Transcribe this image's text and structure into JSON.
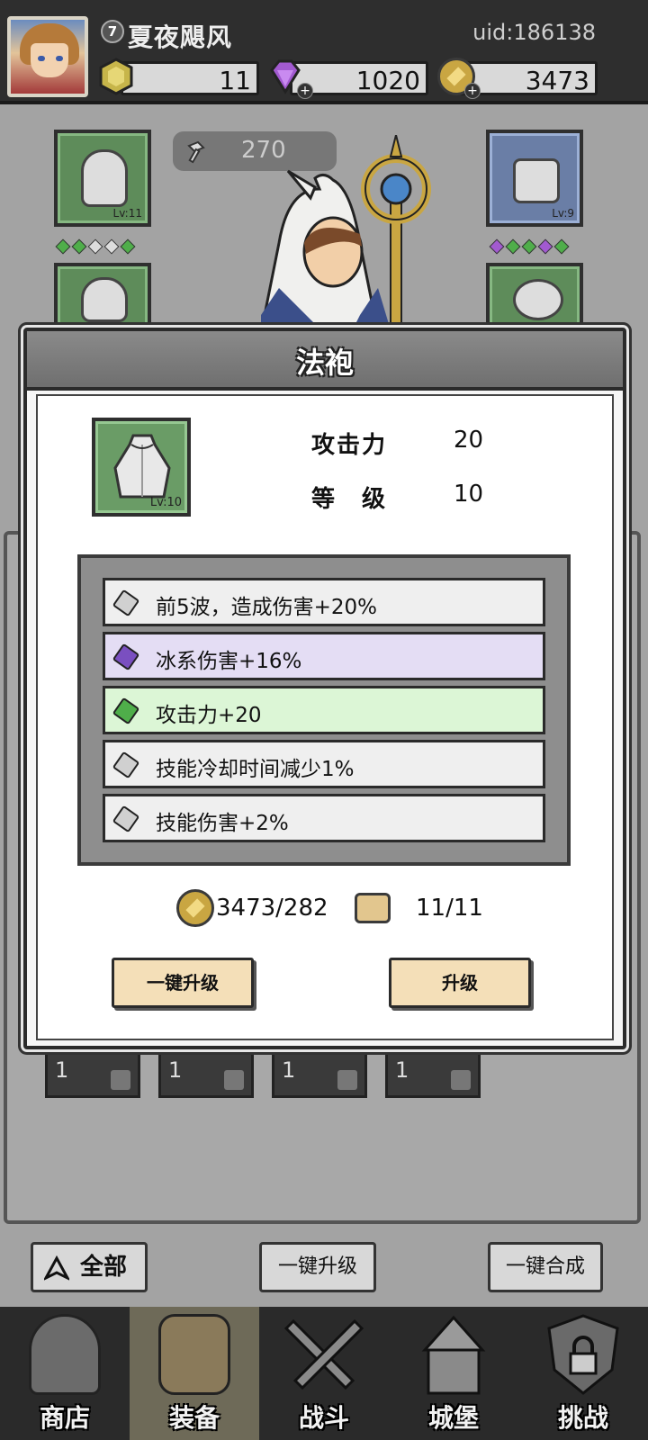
{
  "player": {
    "level": "7",
    "name": "夏夜飓风",
    "uid": "uid:186138"
  },
  "resources": {
    "energy": "11",
    "gems": "1020",
    "gold": "3473",
    "plus": "+"
  },
  "equipment": {
    "power": "270",
    "helmet_level": "Lv:11",
    "weapon_level": "Lv:9"
  },
  "inventory": {
    "counts": [
      "1",
      "1",
      "1",
      "1"
    ]
  },
  "bottom_buttons": {
    "filter_label": "全部",
    "upgrade_all_label": "一键升级",
    "merge_all_label": "一键合成"
  },
  "nav": {
    "items": [
      {
        "label": "商店"
      },
      {
        "label": "装备"
      },
      {
        "label": "战斗"
      },
      {
        "label": "城堡"
      },
      {
        "label": "挑战"
      }
    ]
  },
  "modal": {
    "title": "法袍",
    "item_level": "Lv:10",
    "stats": [
      {
        "label": "攻击力",
        "value": "20"
      },
      {
        "label": "等　级",
        "value": "10"
      }
    ],
    "affixes": [
      {
        "text": "前5波，造成伤害+20%",
        "tier": "common",
        "color": "#efefef",
        "gem_color": "#d0d0d0"
      },
      {
        "text": "冰系伤害+16%",
        "tier": "epic",
        "color": "#e4ddf4",
        "gem_color": "#7a4fc0"
      },
      {
        "text": "攻击力+20",
        "tier": "uncommon",
        "color": "#dcf6d6",
        "gem_color": "#4fae4a"
      },
      {
        "text": "技能冷却时间减少1%",
        "tier": "common",
        "color": "#efefef",
        "gem_color": "#d0d0d0"
      },
      {
        "text": "技能伤害+2%",
        "tier": "common",
        "color": "#efefef",
        "gem_color": "#d0d0d0"
      }
    ],
    "gold_cost": "3473/282",
    "scroll_cost": "11/11",
    "upgrade_all_label": "一键升级",
    "upgrade_label": "升级"
  },
  "colors": {
    "common": "#efefef",
    "epic": "#7a4fc0",
    "uncommon": "#4fae4a",
    "gold": "#c9a642",
    "button": "#f4dfb8"
  }
}
